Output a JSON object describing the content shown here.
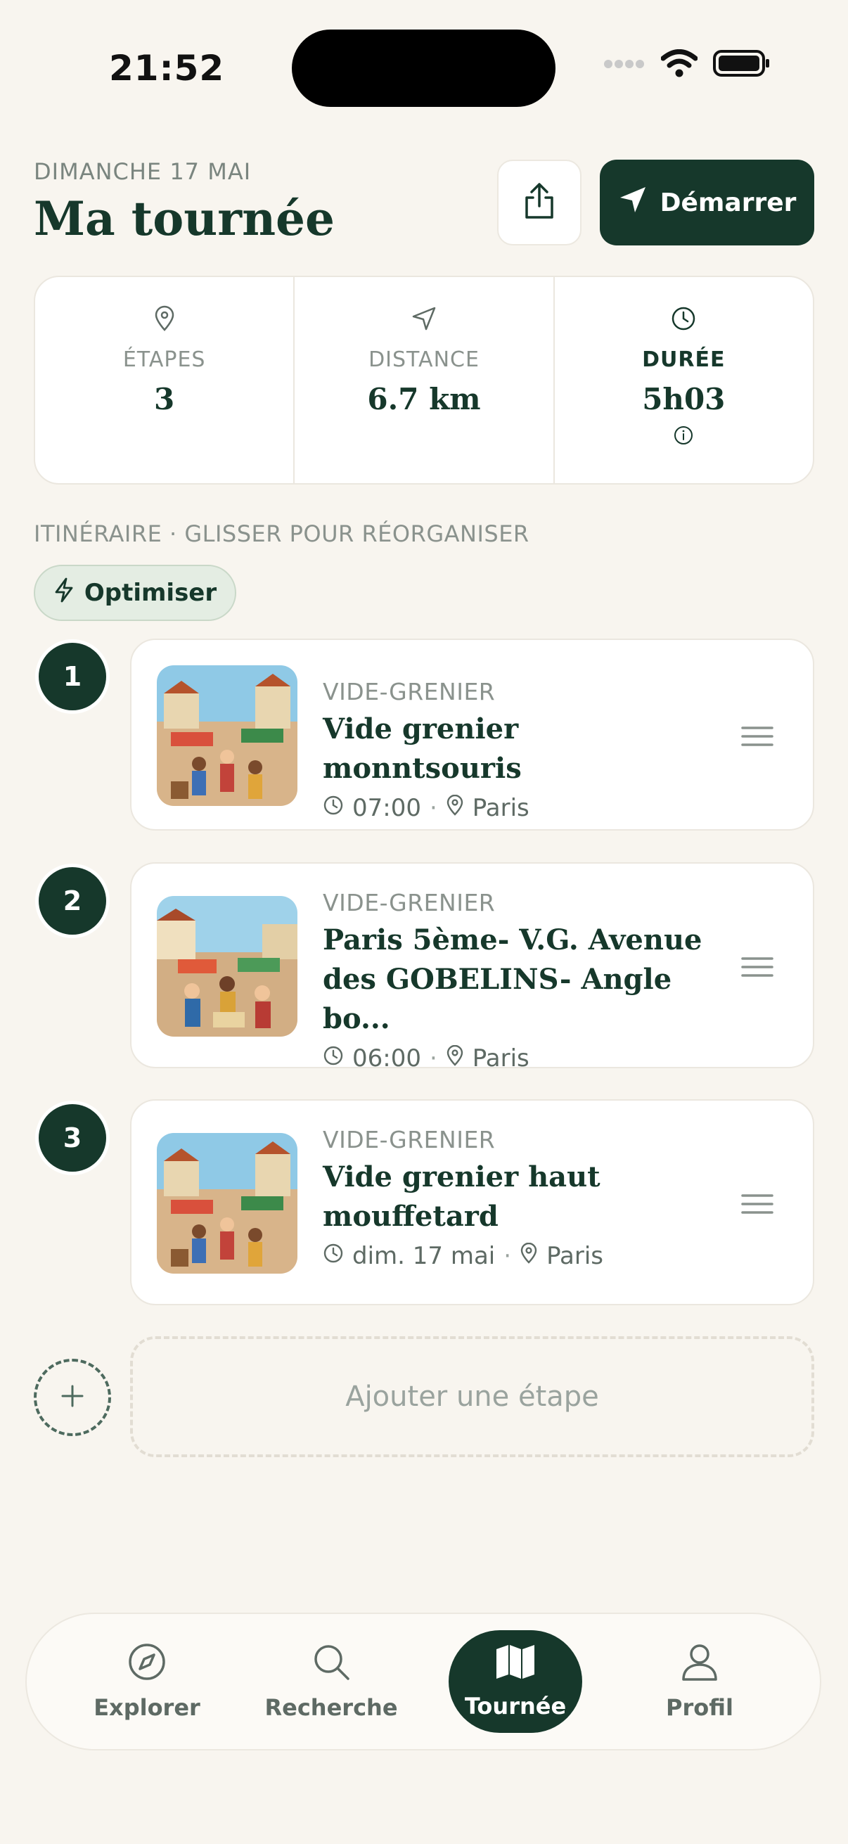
{
  "status_bar": {
    "time": "21:52"
  },
  "header": {
    "date": "DIMANCHE 17 MAI",
    "title": "Ma tournée",
    "start_label": "Démarrer"
  },
  "stats": [
    {
      "icon": "map-pin-icon",
      "label": "ÉTAPES",
      "value": "3"
    },
    {
      "icon": "navigation-icon",
      "label": "DISTANCE",
      "value": "6.7 km"
    },
    {
      "icon": "clock-icon",
      "label": "DURÉE",
      "value": "5h03"
    }
  ],
  "itinerary": {
    "label": "ITINÉRAIRE · GLISSER POUR RÉORGANISER",
    "optimize_label": "Optimiser"
  },
  "stops": [
    {
      "number": "1",
      "category": "VIDE-GRENIER",
      "name": "Vide grenier monntsouris",
      "time": "07:00",
      "city": "Paris"
    },
    {
      "number": "2",
      "category": "VIDE-GRENIER",
      "name": "Paris 5ème- V.G. Avenue des GOBELINS- Angle bo...",
      "time": "06:00",
      "city": "Paris"
    },
    {
      "number": "3",
      "category": "VIDE-GRENIER",
      "name": "Vide grenier haut mouffetard",
      "time": "dim. 17 mai",
      "city": "Paris"
    }
  ],
  "add_stop_label": "Ajouter une étape",
  "tabs": [
    {
      "label": "Explorer",
      "icon": "compass-icon",
      "active": false
    },
    {
      "label": "Recherche",
      "icon": "search-icon",
      "active": false
    },
    {
      "label": "Tournée",
      "icon": "map-icon",
      "active": true
    },
    {
      "label": "Profil",
      "icon": "user-icon",
      "active": false
    }
  ]
}
